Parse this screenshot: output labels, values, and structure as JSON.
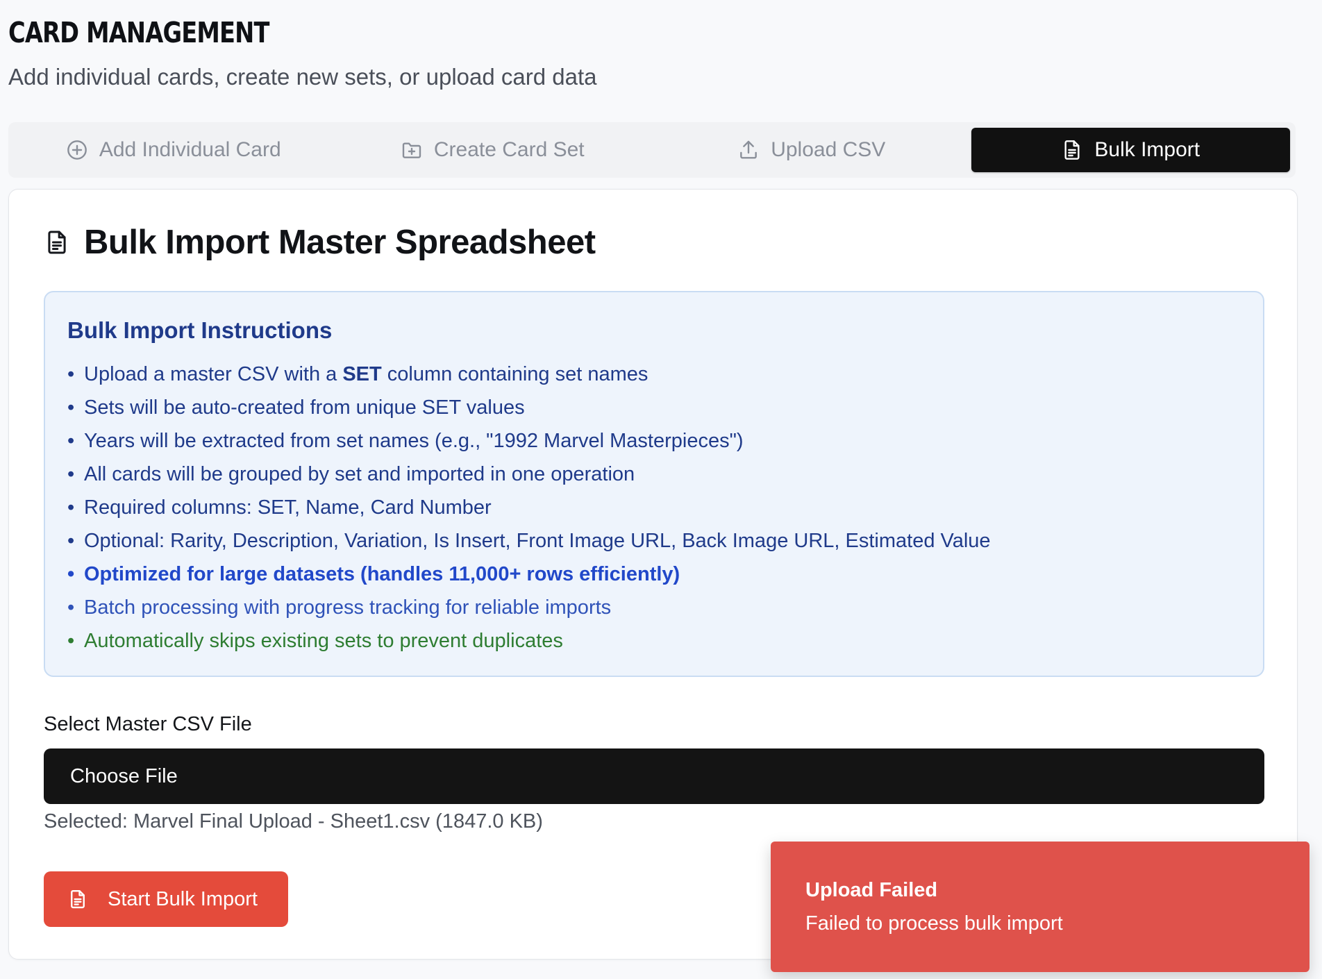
{
  "header": {
    "title": "Card Management",
    "subtitle": "Add individual cards, create new sets, or upload card data"
  },
  "tabs": [
    {
      "label": "Add Individual Card",
      "icon": "plus-circle-icon",
      "active": false
    },
    {
      "label": "Create Card Set",
      "icon": "folder-plus-icon",
      "active": false
    },
    {
      "label": "Upload CSV",
      "icon": "upload-icon",
      "active": false
    },
    {
      "label": "Bulk Import",
      "icon": "document-icon",
      "active": true
    }
  ],
  "panel": {
    "title": "Bulk Import Master Spreadsheet",
    "icon": "document-icon"
  },
  "instructions": {
    "title": "Bulk Import Instructions",
    "bullet": "•",
    "items": [
      {
        "before": "Upload a master CSV with a ",
        "bold": "SET",
        "after": " column containing set names",
        "style": "normal"
      },
      {
        "text": "Sets will be auto-created from unique SET values",
        "style": "normal"
      },
      {
        "text": "Years will be extracted from set names (e.g., \"1992 Marvel Masterpieces\")",
        "style": "normal"
      },
      {
        "text": "All cards will be grouped by set and imported in one operation",
        "style": "normal"
      },
      {
        "text": "Required columns: SET, Name, Card Number",
        "style": "normal"
      },
      {
        "text": "Optional: Rarity, Description, Variation, Is Insert, Front Image URL, Back Image URL, Estimated Value",
        "style": "normal"
      },
      {
        "text": "Optimized for large datasets (handles 11,000+ rows efficiently)",
        "style": "highlight"
      },
      {
        "text": "Batch processing with progress tracking for reliable imports",
        "style": "info"
      },
      {
        "text": "Automatically skips existing sets to prevent duplicates",
        "style": "success"
      }
    ]
  },
  "file_input": {
    "label": "Select Master CSV File",
    "button_label": "Choose File",
    "selected_text": "Selected: Marvel Final Upload - Sheet1.csv (1847.0 KB)"
  },
  "start_button": {
    "label": "Start Bulk Import",
    "icon": "document-icon"
  },
  "toast": {
    "title": "Upload Failed",
    "message": "Failed to process bulk import"
  },
  "colors": {
    "active_tab": "#111111",
    "instructions_bg": "#eef4fc",
    "instructions_text": "#1f3a8a",
    "success_text": "#2e7d32",
    "primary_action": "#e44b3b",
    "toast_error": "#df524b"
  }
}
